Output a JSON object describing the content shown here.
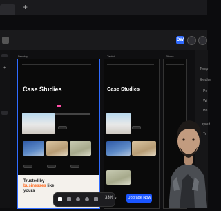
{
  "browser": {
    "new_tab": "+"
  },
  "toolbar": {
    "avatar_initials": "DW"
  },
  "right_panel": {
    "labels": [
      "Temp",
      "Breakp",
      "Po",
      "Wi",
      "He",
      "Layout",
      "To"
    ]
  },
  "frames": [
    {
      "label": "Desktop"
    },
    {
      "label": "Tablet"
    },
    {
      "label": "Phone"
    }
  ],
  "content": {
    "title": "Case Studies",
    "trusted_line1": "Trusted by",
    "trusted_highlight": "businesses",
    "trusted_line2": "like",
    "trusted_line3": "yours"
  },
  "bottom_bar": {
    "zoom": "33%",
    "upgrade_label": "Upgrade Now"
  }
}
